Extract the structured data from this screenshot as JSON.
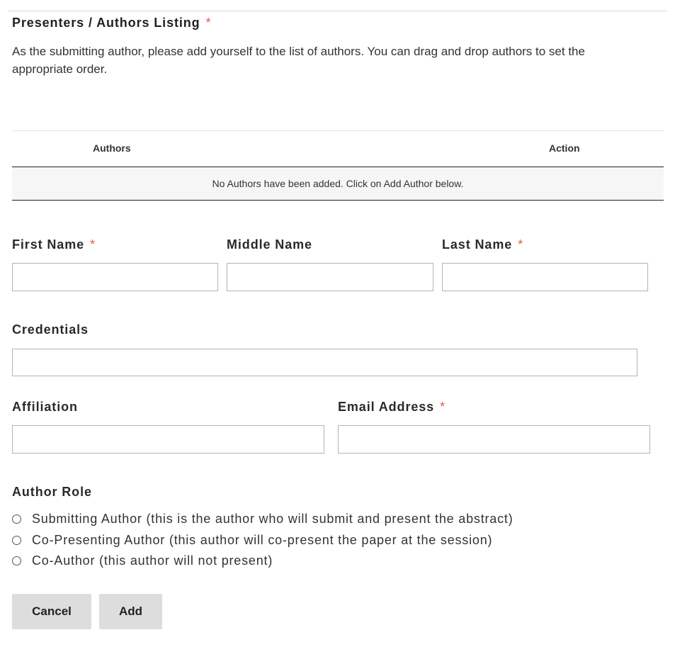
{
  "section": {
    "title": "Presenters / Authors Listing",
    "required_mark": "*",
    "intro": "As the submitting author, please add yourself to the list of authors. You can drag and drop authors to set the appropriate order."
  },
  "authors_table": {
    "columns": [
      "Authors",
      "Action"
    ],
    "empty_message": "No Authors have been added. Click on Add Author below."
  },
  "form": {
    "first_name": {
      "label": "First Name",
      "required": "*",
      "value": ""
    },
    "middle_name": {
      "label": "Middle Name",
      "value": ""
    },
    "last_name": {
      "label": "Last Name",
      "required": "*",
      "value": ""
    },
    "credentials": {
      "label": "Credentials",
      "value": ""
    },
    "affiliation": {
      "label": "Affiliation",
      "value": ""
    },
    "email": {
      "label": "Email Address",
      "required": "*",
      "value": ""
    }
  },
  "author_role": {
    "label": "Author Role",
    "options": [
      {
        "label": "Submitting Author (this is the author who will submit and present the abstract)",
        "selected": false
      },
      {
        "label": "Co-Presenting Author (this author will co-present the paper at the session)",
        "selected": false
      },
      {
        "label": "Co-Author (this author will not present)",
        "selected": false
      }
    ]
  },
  "buttons": {
    "cancel": "Cancel",
    "add": "Add"
  },
  "colors": {
    "required_asterisk": "#e55c4a",
    "button_bg": "#dddddd",
    "empty_row_bg": "#f6f6f6"
  }
}
